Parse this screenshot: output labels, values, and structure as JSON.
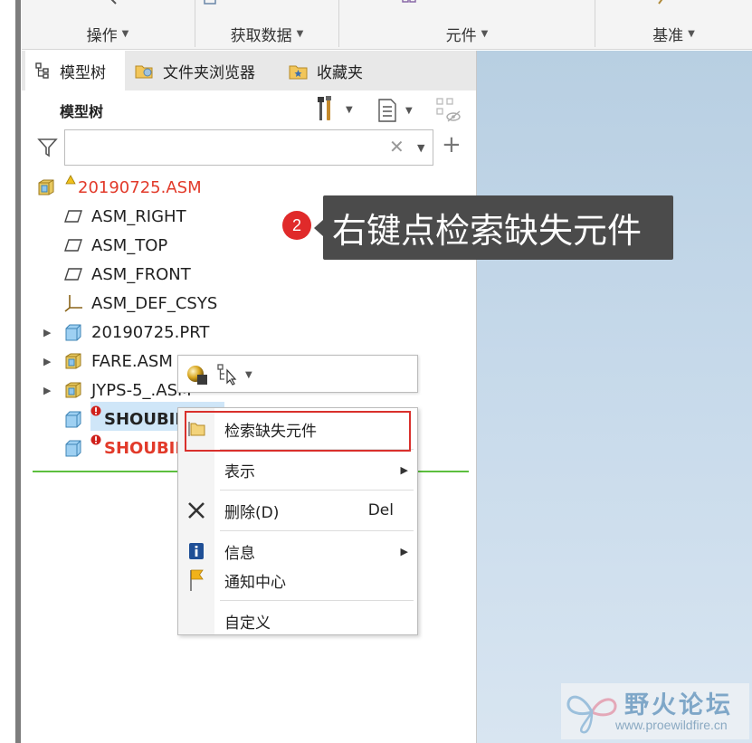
{
  "ribbon": {
    "groups": [
      {
        "label": "操作"
      },
      {
        "label": "获取数据"
      },
      {
        "label": "元件"
      },
      {
        "label": "基准"
      }
    ]
  },
  "tabs": [
    {
      "label": "模型树"
    },
    {
      "label": "文件夹浏览器"
    },
    {
      "label": "收藏夹"
    }
  ],
  "panel": {
    "title": "模型树",
    "search_value": "",
    "search_placeholder": ""
  },
  "tree": [
    {
      "label": "20190725.ASM",
      "icon": "assembly-icon",
      "status": "warning",
      "expandable": false
    },
    {
      "label": "ASM_RIGHT",
      "icon": "datum-plane-icon",
      "expandable": false
    },
    {
      "label": "ASM_TOP",
      "icon": "datum-plane-icon",
      "expandable": false
    },
    {
      "label": "ASM_FRONT",
      "icon": "datum-plane-icon",
      "expandable": false
    },
    {
      "label": "ASM_DEF_CSYS",
      "icon": "coordinate-system-icon",
      "expandable": false
    },
    {
      "label": "20190725.PRT",
      "icon": "part-icon",
      "expandable": true
    },
    {
      "label": "FARE.ASM",
      "icon": "assembly-icon",
      "expandable": true
    },
    {
      "label": "JYPS-5_.ASM",
      "icon": "assembly-icon",
      "expandable": true
    },
    {
      "label": "SHOUBIN",
      "icon": "part-icon",
      "status": "error",
      "selected": true
    },
    {
      "label": "SHOUBIN",
      "icon": "part-icon",
      "status": "error"
    }
  ],
  "callout": {
    "number": "2",
    "text": "右键点检索缺失元件"
  },
  "context_menu": {
    "items": [
      {
        "label": "检索缺失元件",
        "icon": "folder-retrieve-icon"
      },
      {
        "label": "表示",
        "submenu": true
      },
      {
        "label": "删除(D)",
        "shortcut": "Del",
        "icon": "delete-x-icon"
      },
      {
        "label": "信息",
        "submenu": true,
        "icon": "info-icon"
      },
      {
        "label": "通知中心",
        "icon": "flag-icon"
      },
      {
        "label": "自定义"
      }
    ]
  },
  "watermark": {
    "title": "野火论坛",
    "url": "www.proewildfire.cn"
  },
  "colors": {
    "error_red": "#e23a2a",
    "highlight_red": "#d9302c",
    "green_line": "#5cbf3e",
    "selection": "#cfe6f8",
    "callout_bg": "#4b4b4b"
  }
}
